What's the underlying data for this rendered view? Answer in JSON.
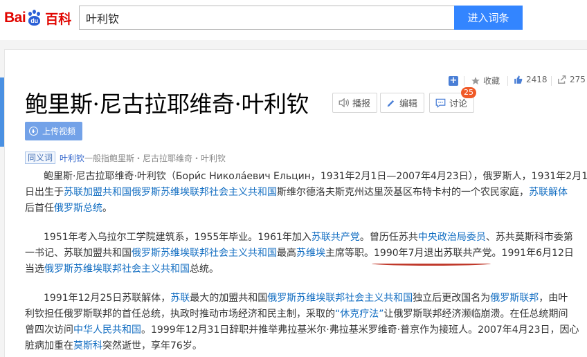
{
  "logo": {
    "bai": "Bai",
    "du": "du",
    "baike": "百科"
  },
  "search": {
    "value": "叶利钦",
    "button": "进入词条"
  },
  "toolbar": {
    "favorite": "收藏",
    "likes": "2418",
    "shares": "275"
  },
  "title": "鲍里斯·尼古拉耶维奇·叶利钦",
  "buttons": {
    "listen": "播报",
    "edit": "编辑",
    "discuss": "讨论",
    "discuss_count": "25",
    "upload_video": "上传视频"
  },
  "synonym": {
    "tag": "同义词",
    "link": "叶利钦",
    "rest": "一般指鲍里斯・尼古拉耶维奇・叶利钦"
  },
  "p1": {
    "l1_a": "鲍里斯·尼古拉耶维奇·叶利钦（Бори́с Никола́евич Ельцин，1931年2月1日—2007年4月23日），俄罗斯人，1931年2月1",
    "l2_a": "日出生于",
    "l2_link1": "苏联加盟共和国俄罗斯苏维埃联邦社会主义共和国",
    "l2_b": "斯维尔德洛夫斯克州达里茨基区布特卡村的一个农民家庭，",
    "l2_link2": "苏联解体",
    "l3_a": "后首任",
    "l3_link": "俄罗斯总统",
    "l3_b": "。"
  },
  "p2": {
    "l1_a": "1951年考入乌拉尔工学院建筑系，1955年毕业。1961年加入",
    "l1_link1": "苏联共产党",
    "l1_b": "。曾历任苏共",
    "l1_link2": "中央政治局委员",
    "l1_c": "、苏共莫斯科市委第",
    "l2_a": "一书记、苏联加盟共和国",
    "l2_link1": "俄罗斯苏维埃联邦社会主义共和国",
    "l2_b": "最高",
    "l2_link2": "苏维埃",
    "l2_c": "主席等职。",
    "l2_mark": "1990年7月退出苏联共产党",
    "l2_d": "。1991年6月12日",
    "l3_a": "当选",
    "l3_link": "俄罗斯苏维埃联邦社会主义共和国",
    "l3_b": "总统。"
  },
  "p3": {
    "l1_a": "1991年12月25日苏联解体，",
    "l1_link1": "苏联",
    "l1_b": "最大的加盟共和国",
    "l1_link2": "俄罗斯苏维埃联邦社会主义共和国",
    "l1_c": "独立后更改国名为",
    "l1_link3": "俄罗斯联邦",
    "l1_d": "，由叶",
    "l2_a": "利钦担任俄罗斯联邦的首任总统，执政时推动市场经济和民主制，采取的",
    "l2_link": "“休克疗法”",
    "l2_b": "让俄罗斯联邦经济濒临崩溃。在任总统期间",
    "l3_a": "曾四次访问",
    "l3_link": "中华人民共和国",
    "l3_b": "。1999年12月31日辞职并推举弗拉基米尔·弗拉基米罗维奇·普京作为接班人。2007年4月23日，因心",
    "l4_a": "脏病加重在",
    "l4_link": "莫斯科",
    "l4_b": "突然逝世，享年76岁。"
  }
}
